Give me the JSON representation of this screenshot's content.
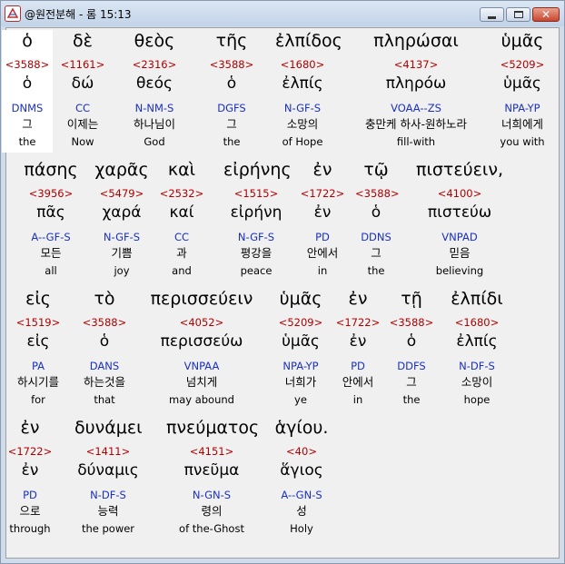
{
  "window": {
    "title": "@원전분해 - 롬 15:13",
    "icon": "bible-app-icon",
    "close_glyph": "✕"
  },
  "rows": [
    {
      "words": [
        {
          "greek": "ὁ",
          "strong": "<3588>",
          "lemma": "ὁ",
          "parse": "DNMS",
          "korean": "그",
          "english": "the",
          "selected": true
        },
        {
          "greek": "δὲ",
          "strong": "<1161>",
          "lemma": "δώ",
          "parse": "CC",
          "korean": "이제는",
          "english": "Now"
        },
        {
          "greek": "θεὸς",
          "strong": "<2316>",
          "lemma": "θεός",
          "parse": "N-NM-S",
          "korean": "하나님이",
          "english": "God"
        },
        {
          "greek": "τῆς",
          "strong": "<3588>",
          "lemma": "ὁ",
          "parse": "DGFS",
          "korean": "그",
          "english": "the"
        },
        {
          "greek": "ἐλπίδος",
          "strong": "<1680>",
          "lemma": "ἐλπίς",
          "parse": "N-GF-S",
          "korean": "소망의",
          "english": "of Hope"
        },
        {
          "greek": "πληρώσαι",
          "strong": "<4137>",
          "lemma": "πληρόω",
          "parse": "VOAA--ZS",
          "korean": "충만케 하사-원하노라",
          "english": "fill-with"
        },
        {
          "greek": "ὑμᾶς",
          "strong": "<5209>",
          "lemma": "ὑμᾶς",
          "parse": "NPA-YP",
          "korean": "너희에게",
          "english": "you with"
        }
      ]
    },
    {
      "words": [
        {
          "greek": "πάσης",
          "strong": "<3956>",
          "lemma": "πᾶς",
          "parse": "A--GF-S",
          "korean": "모든",
          "english": "all"
        },
        {
          "greek": "χαρᾶς",
          "strong": "<5479>",
          "lemma": "χαρά",
          "parse": "N-GF-S",
          "korean": "기쁨",
          "english": "joy"
        },
        {
          "greek": "καὶ",
          "strong": "<2532>",
          "lemma": "καί",
          "parse": "CC",
          "korean": "과",
          "english": "and"
        },
        {
          "greek": "εἰρήνης",
          "strong": "<1515>",
          "lemma": "εἰρήνη",
          "parse": "N-GF-S",
          "korean": "평강을",
          "english": "peace"
        },
        {
          "greek": "ἐν",
          "strong": "<1722>",
          "lemma": "ἐν",
          "parse": "PD",
          "korean": "안에서",
          "english": "in"
        },
        {
          "greek": "τῷ",
          "strong": "<3588>",
          "lemma": "ὁ",
          "parse": "DDNS",
          "korean": "그",
          "english": "the"
        },
        {
          "greek": "πιστεύειν,",
          "strong": "<4100>",
          "lemma": "πιστεύω",
          "parse": "VNPAD",
          "korean": "믿음",
          "english": "believing"
        }
      ]
    },
    {
      "words": [
        {
          "greek": "εἰς",
          "strong": "<1519>",
          "lemma": "εἰς",
          "parse": "PA",
          "korean": "하시기를",
          "english": "for"
        },
        {
          "greek": "τὸ",
          "strong": "<3588>",
          "lemma": "ὁ",
          "parse": "DANS",
          "korean": "하는것을",
          "english": "that"
        },
        {
          "greek": "περισσεύειν",
          "strong": "<4052>",
          "lemma": "περισσεύω",
          "parse": "VNPAA",
          "korean": "넘치게",
          "english": "may abound"
        },
        {
          "greek": "ὑμᾶς",
          "strong": "<5209>",
          "lemma": "ὑμᾶς",
          "parse": "NPA-YP",
          "korean": "너희가",
          "english": "ye"
        },
        {
          "greek": "ἐν",
          "strong": "<1722>",
          "lemma": "ἐν",
          "parse": "PD",
          "korean": "안에서",
          "english": "in"
        },
        {
          "greek": "τῇ",
          "strong": "<3588>",
          "lemma": "ὁ",
          "parse": "DDFS",
          "korean": "그",
          "english": "the"
        },
        {
          "greek": "ἐλπίδι",
          "strong": "<1680>",
          "lemma": "ἐλπίς",
          "parse": "N-DF-S",
          "korean": "소망이",
          "english": "hope"
        }
      ]
    },
    {
      "words": [
        {
          "greek": "ἐν",
          "strong": "<1722>",
          "lemma": "ἐν",
          "parse": "PD",
          "korean": "으로",
          "english": "through"
        },
        {
          "greek": "δυνάμει",
          "strong": "<1411>",
          "lemma": "δύναμις",
          "parse": "N-DF-S",
          "korean": "능력",
          "english": "the power"
        },
        {
          "greek": "πνεύματος",
          "strong": "<4151>",
          "lemma": "πνεῦμα",
          "parse": "N-GN-S",
          "korean": "령의",
          "english": "of the-Ghost"
        },
        {
          "greek": "ἁγίου.",
          "strong": "<40>",
          "lemma": "ἅγιος",
          "parse": "A--GN-S",
          "korean": "성",
          "english": "Holy"
        }
      ]
    }
  ]
}
